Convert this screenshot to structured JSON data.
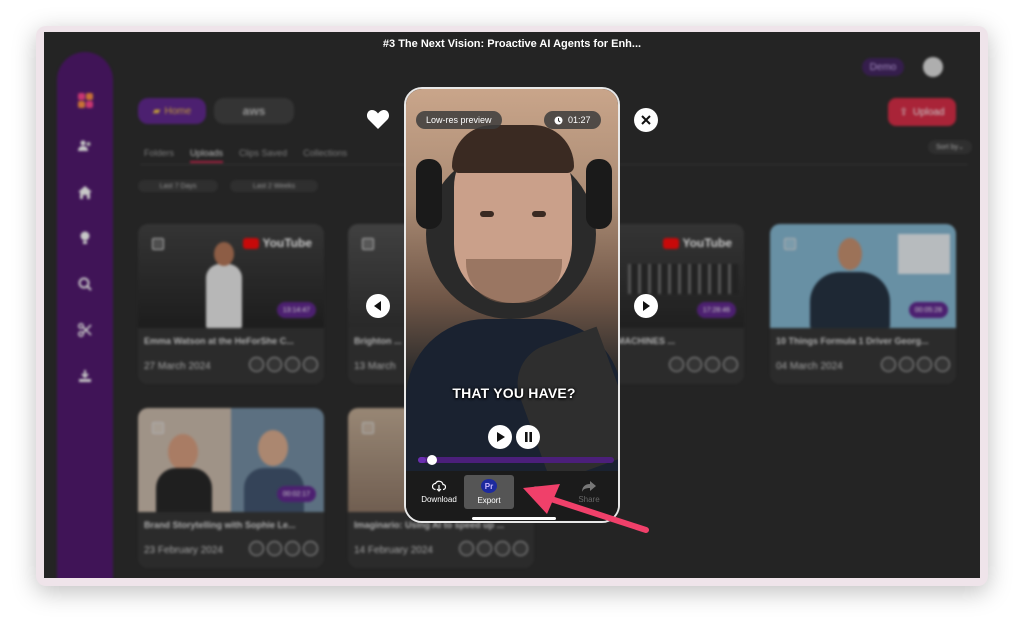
{
  "app": {
    "demo_badge": "Demo",
    "upload_label": "Upload",
    "home_folder": "Home",
    "aws_logo": "aws",
    "sort_label": "Sort by",
    "tabs": [
      "Folders",
      "Uploads",
      "Clips Saved",
      "Collections"
    ],
    "active_tab": "Uploads",
    "filters": [
      "Last 7 Days",
      "Last 2 Weeks"
    ],
    "sidebar_icons": [
      "users-icon",
      "home-icon",
      "lightbulb-icon",
      "search-icon",
      "scissors-icon",
      "download-icon"
    ],
    "cards": [
      {
        "title": "Emma Watson at the HeForShe C...",
        "date": "27 March 2024",
        "duration": "13:14:47",
        "source": "YouTube"
      },
      {
        "title": "Brighton ...",
        "date": "13 March",
        "duration": "",
        "source": ""
      },
      {
        "title": "...UMANOID MACHINES ...",
        "date": "",
        "duration": "17:28:46",
        "source": "YouTube"
      },
      {
        "title": "10 Things Formula 1 Driver Georg...",
        "date": "04 March 2024",
        "duration": "00:05:28",
        "source": ""
      },
      {
        "title": "Brand Storytelling with Sophie Le...",
        "date": "23 February 2024",
        "duration": "00:02:17",
        "source": ""
      },
      {
        "title": "Imaginario: Using AI to speed up ...",
        "date": "14 February 2024",
        "duration": "",
        "source": ""
      }
    ]
  },
  "preview": {
    "title": "#3 The Next Vision: Proactive AI Agents for Enh...",
    "low_res_label": "Low-res preview",
    "duration": "01:27",
    "caption": "THAT YOU HAVE?",
    "progress": 0.04,
    "toolbar": {
      "download": "Download",
      "export": "Export",
      "export_badge": "Pr",
      "share": "Share"
    }
  },
  "colors": {
    "sidebar": "#4a0f69",
    "accent_purple": "#5a1f8a",
    "upload_red": "#d6243f",
    "arrow": "#f0406a"
  }
}
